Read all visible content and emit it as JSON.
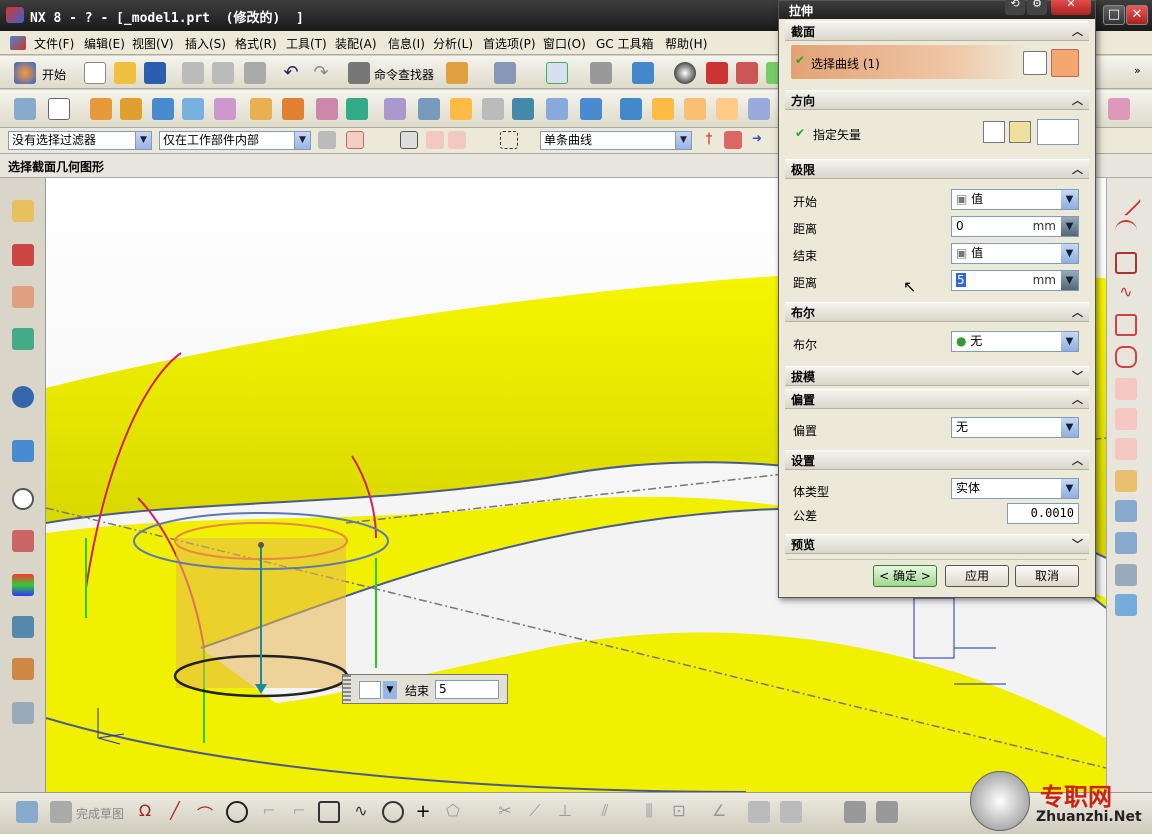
{
  "window": {
    "title": "NX 8 - ? - [_model1.prt  (修改的)  ]"
  },
  "menu": [
    "文件(F)",
    "编辑(E)",
    "视图(V)",
    "插入(S)",
    "格式(R)",
    "工具(T)",
    "装配(A)",
    "信息(I)",
    "分析(L)",
    "首选项(P)",
    "窗口(O)",
    "GC 工具箱",
    "帮助(H)"
  ],
  "toolbar": {
    "start_label": "开始",
    "command_finder_label": "命令查找器"
  },
  "filters": {
    "type_filter": "没有选择过滤器",
    "scope_filter": "仅在工作部件内部",
    "curve_rule": "单条曲线"
  },
  "prompt": "选择截面几何图形",
  "dialog": {
    "title": "拉伸",
    "section": {
      "header": "截面",
      "select_curve": "选择曲线 (1)"
    },
    "direction": {
      "header": "方向",
      "specify_vector": "指定矢量"
    },
    "limits": {
      "header": "极限",
      "start_label": "开始",
      "start_value": "值",
      "start_dist_label": "距离",
      "start_dist": "0",
      "unit": "mm",
      "end_label": "结束",
      "end_value": "值",
      "end_dist_label": "距离",
      "end_dist": "5"
    },
    "boolean": {
      "header": "布尔",
      "label": "布尔",
      "value": "无"
    },
    "draft": {
      "header": "拔模"
    },
    "offset": {
      "header": "偏置",
      "label": "偏置",
      "value": "无"
    },
    "settings": {
      "header": "设置",
      "body_type_label": "体类型",
      "body_type": "实体",
      "tolerance_label": "公差",
      "tolerance": "0.0010"
    },
    "preview": {
      "header": "预览"
    },
    "ok": "< 确定 >",
    "apply": "应用",
    "cancel": "取消"
  },
  "onscreen_input": {
    "label": "结束",
    "value": "5"
  },
  "bottom": {
    "finish_sketch": "完成草图"
  },
  "watermark": {
    "cn": "专职网",
    "url": "Zhuanzhi.Net"
  },
  "colors": {
    "yellow_surface": "#f2f200",
    "accent_orange": "#e07b3a",
    "dialog_bg": "#ece9d8"
  }
}
